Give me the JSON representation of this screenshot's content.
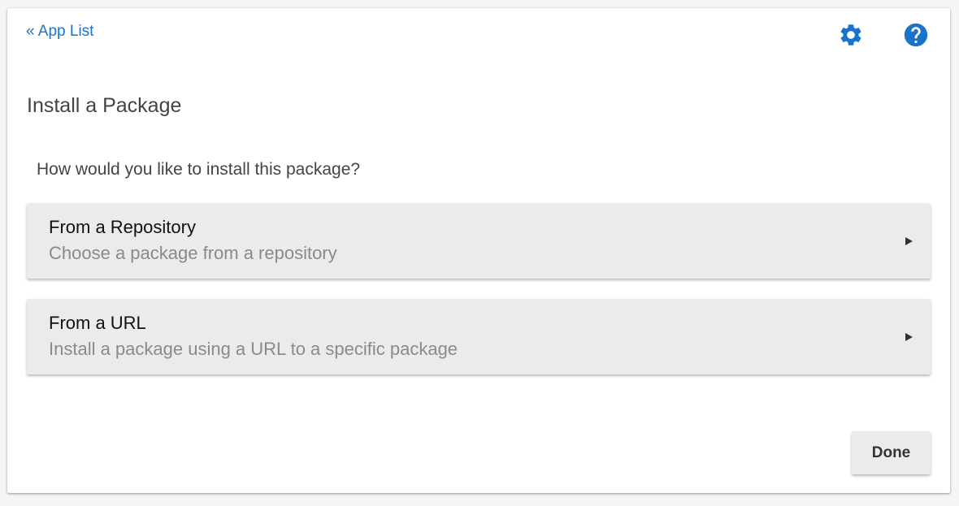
{
  "header": {
    "back_link": "« App List",
    "settings_icon": "gear-icon",
    "help_icon": "help-circle-icon"
  },
  "colors": {
    "accent": "#1a73c8",
    "card_bg": "#ebebeb"
  },
  "main": {
    "title": "Install a Package",
    "question": "How would you like to install this package?",
    "options": [
      {
        "title": "From a Repository",
        "description": "Choose a package from a repository",
        "icon": "arrow-right-icon"
      },
      {
        "title": "From a URL",
        "description": "Install a package using a URL to a specific package",
        "icon": "arrow-right-icon"
      }
    ]
  },
  "footer": {
    "done_label": "Done"
  }
}
